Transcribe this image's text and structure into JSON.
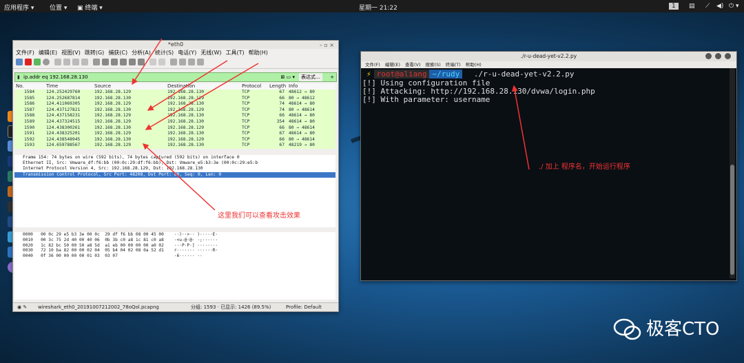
{
  "topbar": {
    "apps": "应用程序 ▾",
    "places": "位置 ▾",
    "terminal": "终端 ▾",
    "clock": "星期一 21:22",
    "badge": "1"
  },
  "wireshark": {
    "title": "*eth0",
    "menu": [
      "文件(F)",
      "编辑(E)",
      "视图(V)",
      "跳转(G)",
      "捕获(C)",
      "分析(A)",
      "统计(S)",
      "电话(Y)",
      "无线(W)",
      "工具(T)",
      "帮助(H)"
    ],
    "filter": "ip.addr eq 192.168.28.130",
    "expression_label": "表达式…",
    "columns": [
      "No.",
      "Time",
      "Source",
      "Destination",
      "Protocol",
      "Length",
      "Info"
    ],
    "packets": [
      {
        "no": "1584",
        "time": "124.252429760",
        "src": "192.168.28.129",
        "dst": "192.168.28.130",
        "proto": "TCP",
        "len": "67",
        "info": "48612 → 80"
      },
      {
        "no": "1585",
        "time": "124.252687814",
        "src": "192.168.28.130",
        "dst": "192.168.28.129",
        "proto": "TCP",
        "len": "66",
        "info": "80 → 48612"
      },
      {
        "no": "1586",
        "time": "124.411069305",
        "src": "192.168.28.129",
        "dst": "192.168.28.130",
        "proto": "TCP",
        "len": "74",
        "info": "48614 → 80"
      },
      {
        "no": "1587",
        "time": "124.437127821",
        "src": "192.168.28.130",
        "dst": "192.168.28.129",
        "proto": "TCP",
        "len": "74",
        "info": "80 → 48614"
      },
      {
        "no": "1588",
        "time": "124.437158231",
        "src": "192.168.28.129",
        "dst": "192.168.28.130",
        "proto": "TCP",
        "len": "66",
        "info": "48614 → 80"
      },
      {
        "no": "1589",
        "time": "124.437324515",
        "src": "192.168.28.129",
        "dst": "192.168.28.130",
        "proto": "TCP",
        "len": "354",
        "info": "48614 → 80"
      },
      {
        "no": "1590",
        "time": "124.438300261",
        "src": "192.168.28.130",
        "dst": "192.168.28.129",
        "proto": "TCP",
        "len": "66",
        "info": "80 → 48614"
      },
      {
        "no": "1591",
        "time": "124.438325201",
        "src": "192.168.28.129",
        "dst": "192.168.28.130",
        "proto": "TCP",
        "len": "67",
        "info": "48614 → 80"
      },
      {
        "no": "1592",
        "time": "124.438548945",
        "src": "192.168.28.130",
        "dst": "192.168.28.129",
        "proto": "TCP",
        "len": "66",
        "info": "80 → 48614"
      },
      {
        "no": "1593",
        "time": "124.659788567",
        "src": "192.168.28.129",
        "dst": "192.168.28.130",
        "proto": "TCP",
        "len": "67",
        "info": "48219 → 80"
      }
    ],
    "details": [
      "Frame 154: 74 bytes on wire (592 bits), 74 bytes captured (592 bits) on interface 0",
      "Ethernet II, Src: Vmware_df:f6:bb (00:0c:29:df:f6:bb), Dst: Vmware_e5:b3:3e (00:0c:29:e5:b",
      "Internet Protocol Version 4, Src: 192.168.28.129, Dst: 192.168.28.130",
      "Transmission Control Protocol, Src Port: 48208, Dst Port: 80, Seq: 0, Len: 0"
    ],
    "hex": [
      "0000   00 0c 29 e5 b3 3e 00 0c  29 df f6 bb 08 00 45 00    ··)··>·· )·····E·",
      "0010   00 3c 75 2d 40 00 40 06  0b 3b c0 a8 1c 81 c0 a8    ·<u-@·@· ·;······",
      "0020   1c 82 bc 50 00 50 a8 5d  a1 eb 00 00 00 00 a0 02    ···P·P·] ········",
      "0030   72 10 ba 82 00 00 02 04  05 b4 04 02 08 0a 52 d1    r······· ······R·",
      "0040   0f 36 00 00 00 00 01 03  03 07                      ·6······ ··"
    ],
    "status_file": "wireshark_eth0_20191007212002_78oQol.pcapng",
    "status_counts": "分组: 1593 · 已显示: 1426 (89.5%)",
    "status_profile": "Profile: Default"
  },
  "terminal": {
    "title": "./r-u-dead-yet-v2.2.py",
    "menu": [
      "文件(F)",
      "编辑(E)",
      "查看(V)",
      "搜索(S)",
      "终端(T)",
      "帮助(H)"
    ],
    "user": "root@aliang",
    "dir": "~/rudy",
    "command": "./r-u-dead-yet-v2.2.py",
    "lines": [
      "[!] Using configuration file",
      "[!] Attacking: http://192.168.28.130/dvwa/login.php",
      "[!] With parameter: username"
    ]
  },
  "annotations": {
    "note_terminal": "./  加上  程序名，开始运行程序",
    "note_wireshark": "这里我们可以查看攻击效果"
  },
  "watermark": "极客CTO",
  "colors": {
    "accent_red": "#e33333",
    "row_green": "#e4ffc7",
    "filter_green": "#aff0a6",
    "selection_blue": "#3b77c7"
  }
}
